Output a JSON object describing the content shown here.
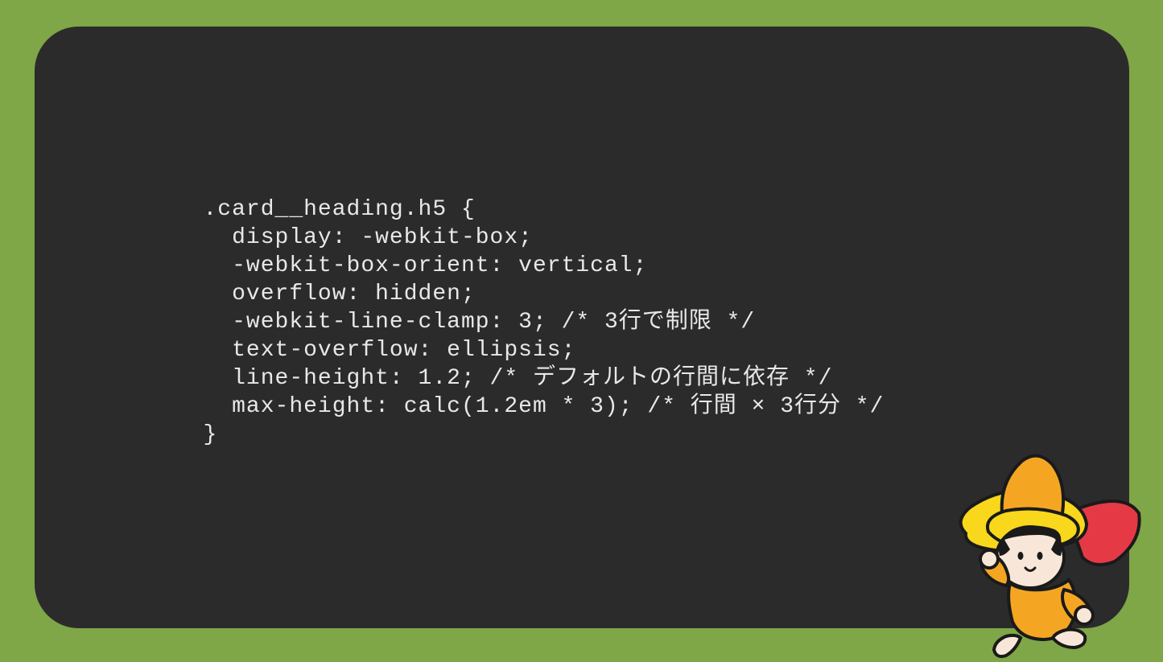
{
  "code": {
    "line1": ".card__heading.h5 {",
    "line2": "  display: -webkit-box;",
    "line3": "  -webkit-box-orient: vertical;",
    "line4": "  overflow: hidden;",
    "line5": "  -webkit-line-clamp: 3; /* 3行で制限 */",
    "line6": "  text-overflow: ellipsis;",
    "line7": "  line-height: 1.2; /* デフォルトの行間に依存 */",
    "line8": "  max-height: calc(1.2em * 3); /* 行間 × 3行分 */",
    "line9": "}"
  }
}
